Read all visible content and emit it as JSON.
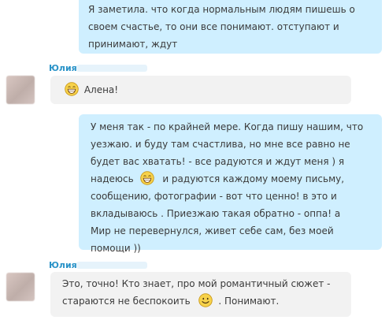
{
  "messages": [
    {
      "direction": "outgoing",
      "lines": [
        "Я заметила. что когда нормальным людям пишешь о",
        "своем счастье, то они все понимают. отступают и",
        "принимают, ждут"
      ]
    },
    {
      "direction": "incoming",
      "sender": "Юлия",
      "emoji": "laughing-emoji",
      "text": "Алена!"
    },
    {
      "direction": "outgoing",
      "lines": [
        "У меня так - по крайней мере. Когда пишу нашим, что",
        "уезжаю. и буду там счастлива, но мне все равно не",
        "будет вас хватать! - все радуются и ждут меня ) я",
        "и радуются каждому моему письму,",
        "сообщению, фотографии - вот что ценно! в это и",
        "вкладываюсь . Приезжаю такая обратно - оппа! а",
        "Мир не перевернулся, живет себе сам, без моей",
        "помощи ))"
      ],
      "inline_line_prefix": "надеюсь",
      "emoji": "laughing-emoji"
    },
    {
      "direction": "incoming",
      "sender": "Юлия",
      "lines": [
        "Это, точно!  Кто знает, про мой романтичный сюжет -",
        "стараются не беспокоить",
        ". Понимают."
      ],
      "emoji": "smile-emoji"
    }
  ]
}
